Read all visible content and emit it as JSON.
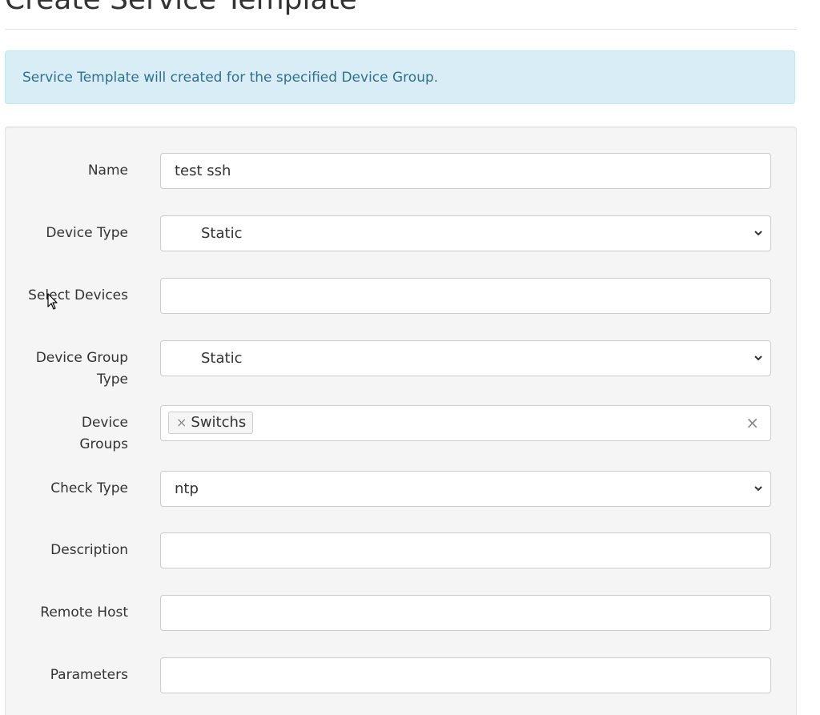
{
  "page": {
    "title": "Create Service Template"
  },
  "alert": {
    "text": "Service Template will created for the specified Device Group."
  },
  "form": {
    "name": {
      "label": "Name",
      "value": "test ssh"
    },
    "device_type": {
      "label": "Device Type",
      "value": "Static"
    },
    "select_devices": {
      "label": "Select Devices",
      "value": ""
    },
    "device_group_type": {
      "label_line1": "Device Group",
      "label_line2": "Type",
      "value": "Static"
    },
    "device_groups": {
      "label_line1": "Device",
      "label_line2": "Groups",
      "tags": [
        {
          "label": "Switchs",
          "remove_glyph": "×"
        }
      ],
      "clear_glyph": "×"
    },
    "check_type": {
      "label": "Check Type",
      "value": "ntp"
    },
    "description": {
      "label": "Description",
      "value": ""
    },
    "remote_host": {
      "label": "Remote Host",
      "value": ""
    },
    "parameters": {
      "label": "Parameters",
      "value": ""
    }
  },
  "icons": {
    "select_arrow": "chevron-down-icon",
    "tag_remove": "close-icon",
    "clear_all": "close-icon",
    "pointer": "mouse-cursor-icon"
  },
  "colors": {
    "alert_bg": "#d9edf7",
    "alert_text": "#31708f",
    "well_bg": "#f5f5f5",
    "border": "#cccccc"
  }
}
